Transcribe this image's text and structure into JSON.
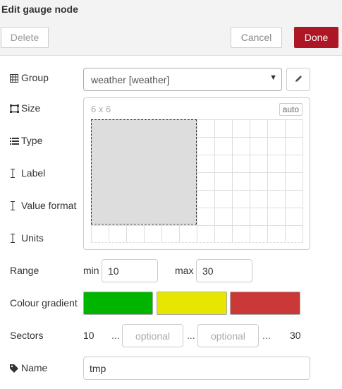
{
  "window": {
    "title": "Edit gauge node"
  },
  "toolbar": {
    "delete_label": "Delete",
    "cancel_label": "Cancel",
    "done_label": "Done"
  },
  "form": {
    "group": {
      "label": "Group",
      "value": "weather [weather]",
      "icon": "table-icon"
    },
    "size": {
      "label": "Size",
      "value": "6 x 6",
      "auto_label": "auto",
      "icon": "size-icon"
    },
    "type": {
      "label": "Type",
      "icon": "list-icon"
    },
    "label": {
      "label": "Label",
      "icon": "text-cursor-icon"
    },
    "value_format": {
      "label": "Value format",
      "icon": "text-cursor-icon"
    },
    "units": {
      "label": "Units",
      "icon": "text-cursor-icon"
    },
    "range": {
      "label": "Range",
      "min_label": "min",
      "min_value": "10",
      "max_label": "max",
      "max_value": "30"
    },
    "colour_gradient": {
      "label": "Colour gradient",
      "colors": [
        "#00b500",
        "#e6e600",
        "#ca3838"
      ]
    },
    "sectors": {
      "label": "Sectors",
      "start": "10",
      "end": "30",
      "placeholder1": "optional",
      "placeholder2": "optional",
      "sep": "..."
    },
    "name": {
      "label": "Name",
      "value": "tmp",
      "icon": "tag-icon"
    }
  }
}
